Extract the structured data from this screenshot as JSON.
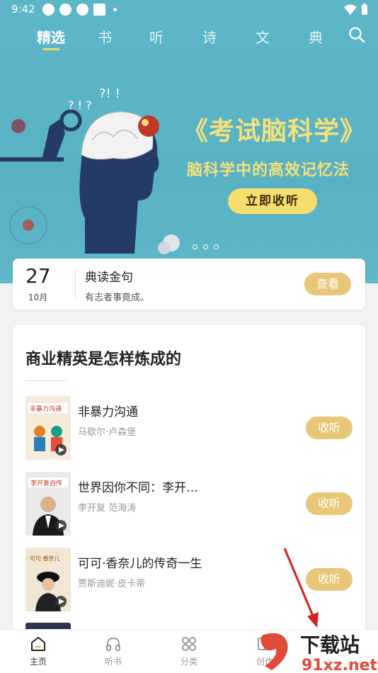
{
  "status": {
    "time": "9:42"
  },
  "top_nav": {
    "tabs": [
      {
        "label": "精选",
        "active": true
      },
      {
        "label": "书",
        "active": false
      },
      {
        "label": "听",
        "active": false
      },
      {
        "label": "诗",
        "active": false
      },
      {
        "label": "文",
        "active": false
      },
      {
        "label": "典",
        "active": false
      }
    ],
    "search_icon": "search-icon"
  },
  "banner": {
    "title": "《考试脑科学》",
    "subtitle": "脑科学中的高效记忆法",
    "button": "立即收听",
    "page_count": 4,
    "current_page": 1
  },
  "daily_quote": {
    "day": "27",
    "month": "10月",
    "title": "典读金句",
    "quote": "有志者事竟成。",
    "button": "查看"
  },
  "book_list": {
    "title": "商业精英是怎样炼成的",
    "items": [
      {
        "title": "非暴力沟通",
        "author": "马歇尔·卢森堡",
        "button": "收听",
        "cover_text": "非暴力沟通"
      },
      {
        "title": "世界因你不同：李开…",
        "author": "李开复 范海涛",
        "button": "收听",
        "cover_text": "李开复自传"
      },
      {
        "title": "可可·香奈儿的传奇一生",
        "author": "贾斯迪妮·皮卡蒂",
        "button": "收听",
        "cover_text": "可可·香奈儿"
      }
    ]
  },
  "bottom_nav": {
    "items": [
      {
        "label": "主页",
        "icon": "home-icon",
        "active": true
      },
      {
        "label": "听书",
        "icon": "headphones-icon",
        "active": false
      },
      {
        "label": "分类",
        "icon": "category-icon",
        "active": false
      },
      {
        "label": "创作",
        "icon": "book-icon",
        "active": false
      }
    ]
  },
  "watermark": {
    "text1": "下载站",
    "text2": "91xz.net"
  },
  "colors": {
    "teal": "#5cb6c8",
    "gold": "#e8c878",
    "banner_yellow": "#f6e07a"
  }
}
